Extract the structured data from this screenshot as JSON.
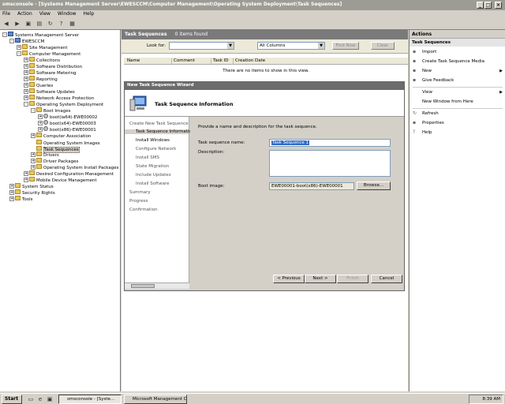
{
  "window": {
    "title": "smsconsole - [Systems Management Server\\EWESCCM\\Computer Management\\Operating System Deployment\\Task Sequences]"
  },
  "menu": [
    "File",
    "Action",
    "View",
    "Window",
    "Help"
  ],
  "tree": {
    "items": [
      {
        "label": "Systems Management Server",
        "level": 0,
        "exp": "-",
        "icon": "pc"
      },
      {
        "label": "EWESCCM",
        "level": 1,
        "exp": "-",
        "icon": "pc"
      },
      {
        "label": "Site Management",
        "level": 2,
        "exp": "+",
        "icon": "folder"
      },
      {
        "label": "Computer Management",
        "level": 2,
        "exp": "-",
        "icon": "folder"
      },
      {
        "label": "Collections",
        "level": 3,
        "exp": "+",
        "icon": "folder"
      },
      {
        "label": "Software Distribution",
        "level": 3,
        "exp": "+",
        "icon": "folder"
      },
      {
        "label": "Software Metering",
        "level": 3,
        "exp": "+",
        "icon": "folder"
      },
      {
        "label": "Reporting",
        "level": 3,
        "exp": "+",
        "icon": "folder"
      },
      {
        "label": "Queries",
        "level": 3,
        "exp": "+",
        "icon": "folder"
      },
      {
        "label": "Software Updates",
        "level": 3,
        "exp": "+",
        "icon": "folder"
      },
      {
        "label": "Network Access Protection",
        "level": 3,
        "exp": "+",
        "icon": "folder"
      },
      {
        "label": "Operating System Deployment",
        "level": 3,
        "exp": "-",
        "icon": "folder"
      },
      {
        "label": "Boot Images",
        "level": 4,
        "exp": "-",
        "icon": "folder"
      },
      {
        "label": "boot(ia64)-EWE00002",
        "level": 5,
        "exp": "+",
        "icon": "disc"
      },
      {
        "label": "boot(x64)-EWE00003",
        "level": 5,
        "exp": "+",
        "icon": "disc"
      },
      {
        "label": "boot(x86)-EWE00001",
        "level": 5,
        "exp": "+",
        "icon": "disc"
      },
      {
        "label": "Computer Association",
        "level": 4,
        "exp": "+",
        "icon": "folder"
      },
      {
        "label": "Operating System Images",
        "level": 4,
        "exp": "",
        "icon": "folder"
      },
      {
        "label": "Task Sequences",
        "level": 4,
        "exp": "",
        "icon": "folder",
        "selected": true
      },
      {
        "label": "Drivers",
        "level": 4,
        "exp": "+",
        "icon": "folder"
      },
      {
        "label": "Driver Packages",
        "level": 4,
        "exp": "+",
        "icon": "folder"
      },
      {
        "label": "Operating System Install Packages",
        "level": 4,
        "exp": "+",
        "icon": "folder"
      },
      {
        "label": "Desired Configuration Management",
        "level": 3,
        "exp": "+",
        "icon": "folder"
      },
      {
        "label": "Mobile Device Management",
        "level": 3,
        "exp": "+",
        "icon": "folder"
      },
      {
        "label": "System Status",
        "level": 1,
        "exp": "+",
        "icon": "folder"
      },
      {
        "label": "Security Rights",
        "level": 1,
        "exp": "+",
        "icon": "folder"
      },
      {
        "label": "Tools",
        "level": 1,
        "exp": "+",
        "icon": "folder"
      }
    ]
  },
  "center": {
    "title": "Task Sequences",
    "count": "0 items found",
    "look_for_label": "Look for:",
    "look_for_value": "",
    "in_value": "All Columns",
    "find_now": "Find Now",
    "clear": "Clear",
    "columns": [
      "Name",
      "Comment",
      "Task ID",
      "Creation Date"
    ],
    "empty_text": "There are no items to show in this view."
  },
  "wizard": {
    "title": "New Task Sequence Wizard",
    "header": "Task Sequence Information",
    "steps": [
      {
        "label": "Create New Task Sequence",
        "sub": false,
        "current": false
      },
      {
        "label": "Task Sequence Information",
        "sub": true,
        "current": true
      },
      {
        "label": "Install Windows",
        "sub": true,
        "current": false,
        "active": true
      },
      {
        "label": "Configure Network",
        "sub": true,
        "current": false
      },
      {
        "label": "Install SMS",
        "sub": true,
        "current": false
      },
      {
        "label": "State Migration",
        "sub": true,
        "current": false
      },
      {
        "label": "Include Updates",
        "sub": true,
        "current": false
      },
      {
        "label": "Install Software",
        "sub": true,
        "current": false
      },
      {
        "label": "Summary",
        "sub": false,
        "current": false
      },
      {
        "label": "Progress",
        "sub": false,
        "current": false
      },
      {
        "label": "Confirmation",
        "sub": false,
        "current": false
      }
    ],
    "intro": "Provide a name and description for the task sequence.",
    "name_label": "Task sequence name:",
    "name_value": "Task Sequence 1",
    "desc_label": "Description:",
    "desc_value": "",
    "boot_label": "Boot image:",
    "boot_value": "EWE00001-boot(x86)-EWE00001",
    "browse": "Browse...",
    "prev": "< Previous",
    "next": "Next >",
    "finish": "Finish",
    "cancel": "Cancel"
  },
  "actions": {
    "title": "Actions",
    "section": "Task Sequences",
    "items": [
      {
        "label": "Import",
        "icon": "import-icon",
        "sub": false
      },
      {
        "label": "Create Task Sequence Media",
        "icon": "media-icon",
        "sub": false
      },
      {
        "label": "New",
        "icon": "new-icon",
        "sub": true
      },
      {
        "label": "Give Feedback",
        "icon": "feedback-icon",
        "sub": false
      },
      {
        "label": "View",
        "icon": "",
        "sub": true
      },
      {
        "label": "New Window from Here",
        "icon": "",
        "sub": false
      },
      {
        "label": "Refresh",
        "icon": "refresh-icon",
        "sub": false
      },
      {
        "label": "Properties",
        "icon": "properties-icon",
        "sub": false
      },
      {
        "label": "Help",
        "icon": "help-icon",
        "sub": false
      }
    ]
  },
  "taskbar": {
    "start": "Start",
    "tasks": [
      "smsconsole - [Syste...",
      "Microsoft Management C..."
    ],
    "clock": "8:39 AM"
  }
}
